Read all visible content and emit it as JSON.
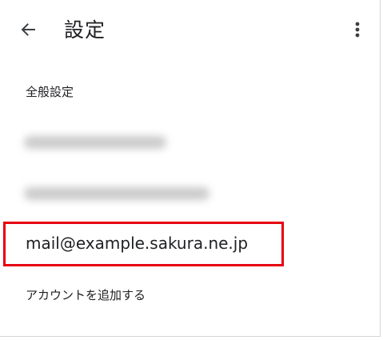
{
  "header": {
    "title": "設定",
    "back_icon": "arrow-left-icon",
    "more_icon": "more-vert-icon"
  },
  "settings": {
    "general_label": "全般設定",
    "accounts": [
      {
        "email": "",
        "obscured": true
      },
      {
        "email": "",
        "obscured": true
      },
      {
        "email": "mail@example.sakura.ne.jp",
        "obscured": false
      }
    ],
    "add_account_label": "アカウントを追加する"
  },
  "annotation": {
    "highlight_color": "#e60012"
  }
}
